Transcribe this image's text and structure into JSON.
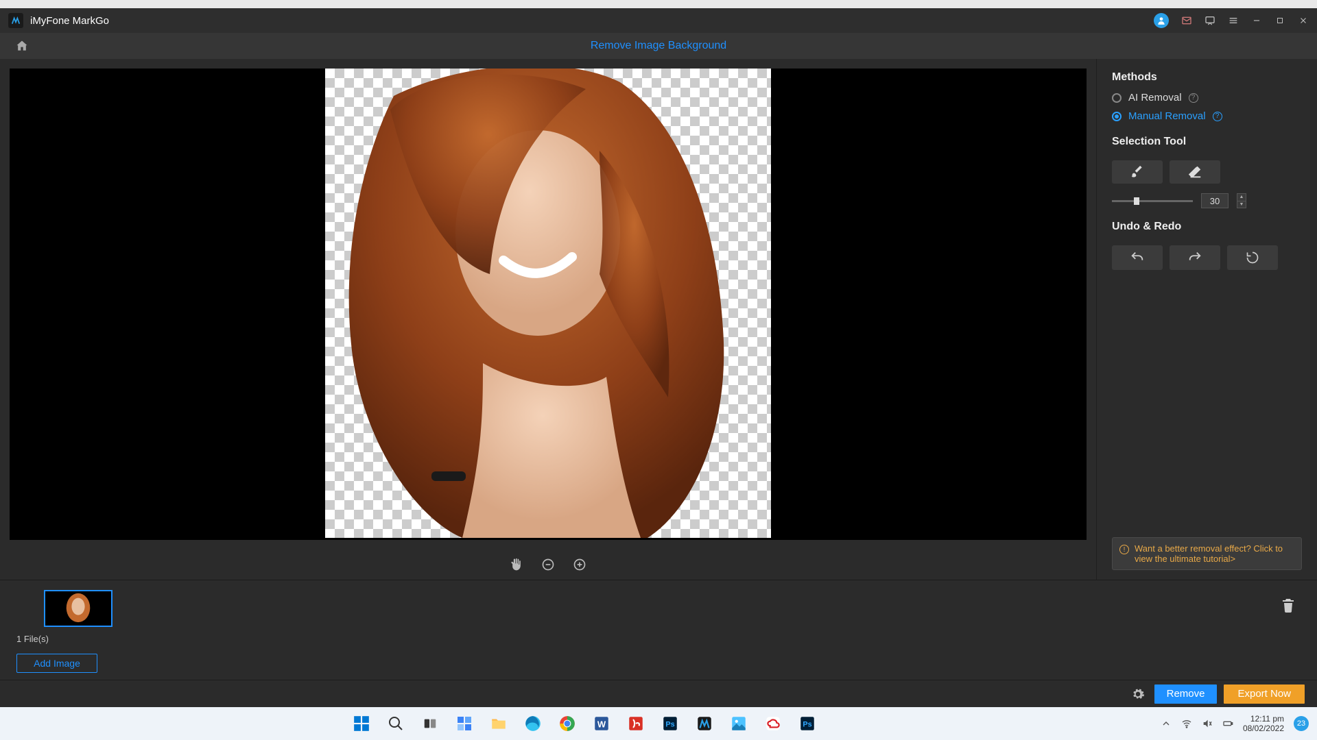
{
  "app": {
    "title": "iMyFone MarkGo"
  },
  "header": {
    "page_title": "Remove Image Background"
  },
  "panel": {
    "methods_heading": "Methods",
    "ai_removal_label": "AI Removal",
    "manual_removal_label": "Manual Removal",
    "selection_tool_heading": "Selection Tool",
    "brush_size_value": "30",
    "undo_redo_heading": "Undo & Redo",
    "tutorial_tip": "Want a better removal effect? Click to view the ultimate tutorial>"
  },
  "bottom": {
    "file_count": "1 File(s)",
    "add_image_label": "Add Image"
  },
  "actions": {
    "remove_label": "Remove",
    "export_label": "Export Now"
  },
  "taskbar": {
    "time": "12:11 pm",
    "date": "08/02/2022",
    "notif_count": "23"
  }
}
